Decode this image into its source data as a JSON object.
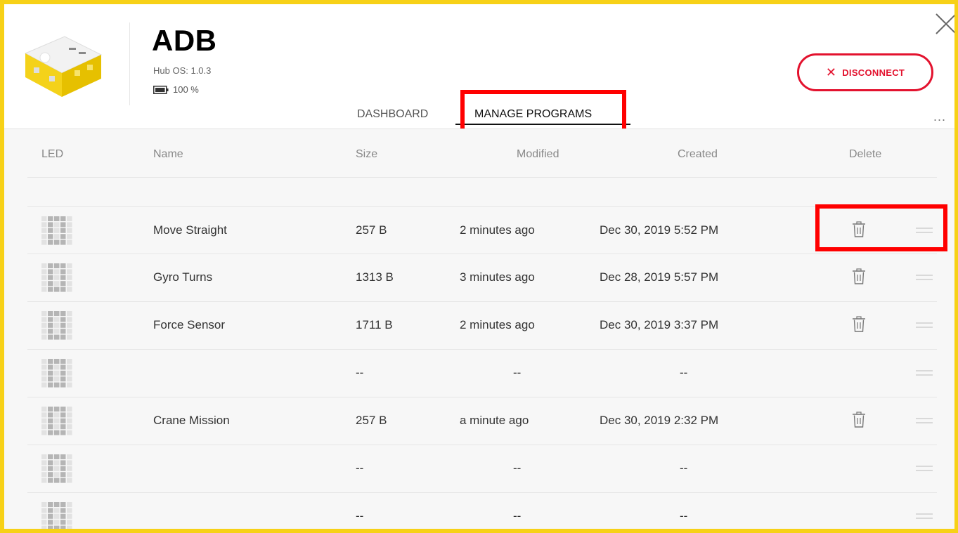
{
  "hub": {
    "name": "ADB",
    "os": "Hub OS: 1.0.3",
    "battery": "100 %"
  },
  "actions": {
    "disconnect_label": "DISCONNECT"
  },
  "tabs": [
    {
      "label": "DASHBOARD",
      "active": false
    },
    {
      "label": "MANAGE PROGRAMS",
      "active": true
    }
  ],
  "more_label": "...",
  "table": {
    "headers": {
      "led": "LED",
      "name": "Name",
      "size": "Size",
      "modified": "Modified",
      "created": "Created",
      "delete": "Delete"
    },
    "rows": [
      {
        "name": "Move Straight",
        "size": "257 B",
        "modified": "2 minutes ago",
        "created": "Dec 30, 2019 5:52 PM",
        "deletable": true
      },
      {
        "name": "Gyro Turns",
        "size": "1313 B",
        "modified": "3 minutes ago",
        "created": "Dec 28, 2019 5:57 PM",
        "deletable": true
      },
      {
        "name": "Force Sensor",
        "size": "1711 B",
        "modified": "2 minutes ago",
        "created": "Dec 30, 2019 3:37 PM",
        "deletable": true
      },
      {
        "name": "",
        "size": "--",
        "modified": "--",
        "created": "--",
        "deletable": false
      },
      {
        "name": "Crane Mission",
        "size": "257 B",
        "modified": "a minute ago",
        "created": "Dec 30, 2019 2:32 PM",
        "deletable": true
      },
      {
        "name": "",
        "size": "--",
        "modified": "--",
        "created": "--",
        "deletable": false
      },
      {
        "name": "",
        "size": "--",
        "modified": "--",
        "created": "--",
        "deletable": false
      }
    ]
  },
  "colors": {
    "frame": "#f7d117",
    "accent_red": "#e3122e",
    "highlight": "#ff0000"
  }
}
